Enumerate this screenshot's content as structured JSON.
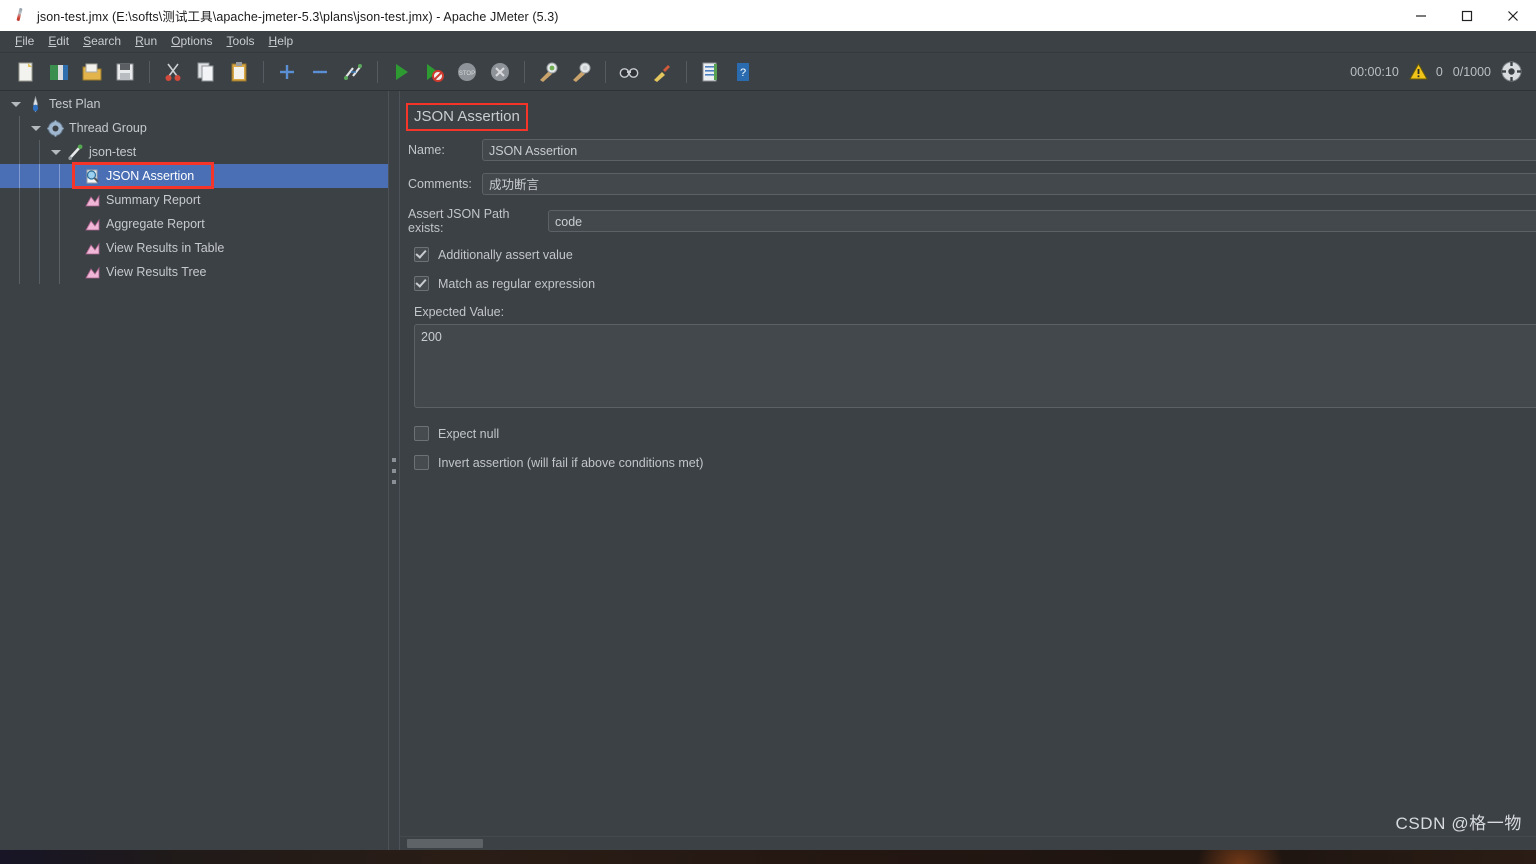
{
  "window": {
    "title": "json-test.jmx (E:\\softs\\测试工具\\apache-jmeter-5.3\\plans\\json-test.jmx) - Apache JMeter (5.3)",
    "app_icon": "jmeter-feather-icon",
    "controls": {
      "minimize": "minimize-icon",
      "maximize": "maximize-icon",
      "close": "close-icon"
    }
  },
  "menubar": {
    "items": [
      {
        "label": "File",
        "mnemonic": "F"
      },
      {
        "label": "Edit",
        "mnemonic": "E"
      },
      {
        "label": "Search",
        "mnemonic": "S"
      },
      {
        "label": "Run",
        "mnemonic": "R"
      },
      {
        "label": "Options",
        "mnemonic": "O"
      },
      {
        "label": "Tools",
        "mnemonic": "T"
      },
      {
        "label": "Help",
        "mnemonic": "H"
      }
    ]
  },
  "toolbar": {
    "buttons": [
      {
        "name": "new-icon",
        "title": "New"
      },
      {
        "name": "templates-icon",
        "title": "Templates"
      },
      {
        "name": "open-icon",
        "title": "Open"
      },
      {
        "name": "save-icon",
        "title": "Save Test Plan"
      },
      {
        "name": "cut-icon",
        "title": "Cut"
      },
      {
        "name": "copy-icon",
        "title": "Copy"
      },
      {
        "name": "paste-icon",
        "title": "Paste"
      },
      {
        "name": "expand-all-icon",
        "title": "Expand All"
      },
      {
        "name": "collapse-all-icon",
        "title": "Collapse All"
      },
      {
        "name": "toggle-icon",
        "title": "Toggle"
      },
      {
        "name": "start-icon",
        "title": "Start"
      },
      {
        "name": "start-no-pauses-icon",
        "title": "Start no pauses"
      },
      {
        "name": "stop-icon",
        "title": "Stop"
      },
      {
        "name": "shutdown-icon",
        "title": "Shutdown"
      },
      {
        "name": "clear-icon",
        "title": "Clear"
      },
      {
        "name": "clear-all-icon",
        "title": "Clear All"
      },
      {
        "name": "search-icon",
        "title": "Search"
      },
      {
        "name": "reset-search-icon",
        "title": "Reset Search"
      },
      {
        "name": "function-helper-icon",
        "title": "Function Helper Dialog"
      },
      {
        "name": "help-icon",
        "title": "Help"
      }
    ],
    "status": {
      "elapsed_time": "00:00:10",
      "warning_icon": "warning-triangle-icon",
      "warning_count": "0",
      "threads": "0/1000",
      "remote_icon": "remote-engines-icon"
    }
  },
  "tree": {
    "nodes": [
      {
        "label": "Test Plan",
        "icon": "test-plan-icon",
        "depth": 0,
        "expanded": true,
        "selected": false
      },
      {
        "label": "Thread Group",
        "icon": "thread-group-icon",
        "depth": 1,
        "expanded": true,
        "selected": false
      },
      {
        "label": "json-test",
        "icon": "http-sampler-icon",
        "depth": 2,
        "expanded": true,
        "selected": false
      },
      {
        "label": "JSON Assertion",
        "icon": "assertion-icon",
        "depth": 3,
        "expanded": false,
        "selected": true
      },
      {
        "label": "Summary Report",
        "icon": "listener-icon",
        "depth": 3,
        "expanded": false,
        "selected": false
      },
      {
        "label": "Aggregate Report",
        "icon": "listener-icon",
        "depth": 3,
        "expanded": false,
        "selected": false
      },
      {
        "label": "View Results in Table",
        "icon": "listener-icon",
        "depth": 3,
        "expanded": false,
        "selected": false
      },
      {
        "label": "View Results Tree",
        "icon": "listener-icon",
        "depth": 3,
        "expanded": false,
        "selected": false
      }
    ]
  },
  "panel": {
    "title": "JSON Assertion",
    "highlight_color": "#f5342a",
    "fields": {
      "name_label": "Name:",
      "name_value": "JSON Assertion",
      "comments_label": "Comments:",
      "comments_value": "成功断言",
      "json_path_label": "Assert JSON Path exists:",
      "json_path_value": "code",
      "expected_value_label": "Expected Value:",
      "expected_value": "200"
    },
    "checkboxes": [
      {
        "label": "Additionally assert value",
        "checked": true
      },
      {
        "label": "Match as regular expression",
        "checked": true
      },
      {
        "label": "Expect null",
        "checked": false
      },
      {
        "label": "Invert assertion (will fail if above conditions met)",
        "checked": false
      }
    ]
  },
  "watermark": "CSDN @格一物",
  "colors": {
    "background": "#3c4145",
    "selection": "#4a6fb4",
    "field_bg": "#43484c",
    "text": "#c9cdd1",
    "titlebar": "#ffffff",
    "annotation": "#f5342a"
  }
}
